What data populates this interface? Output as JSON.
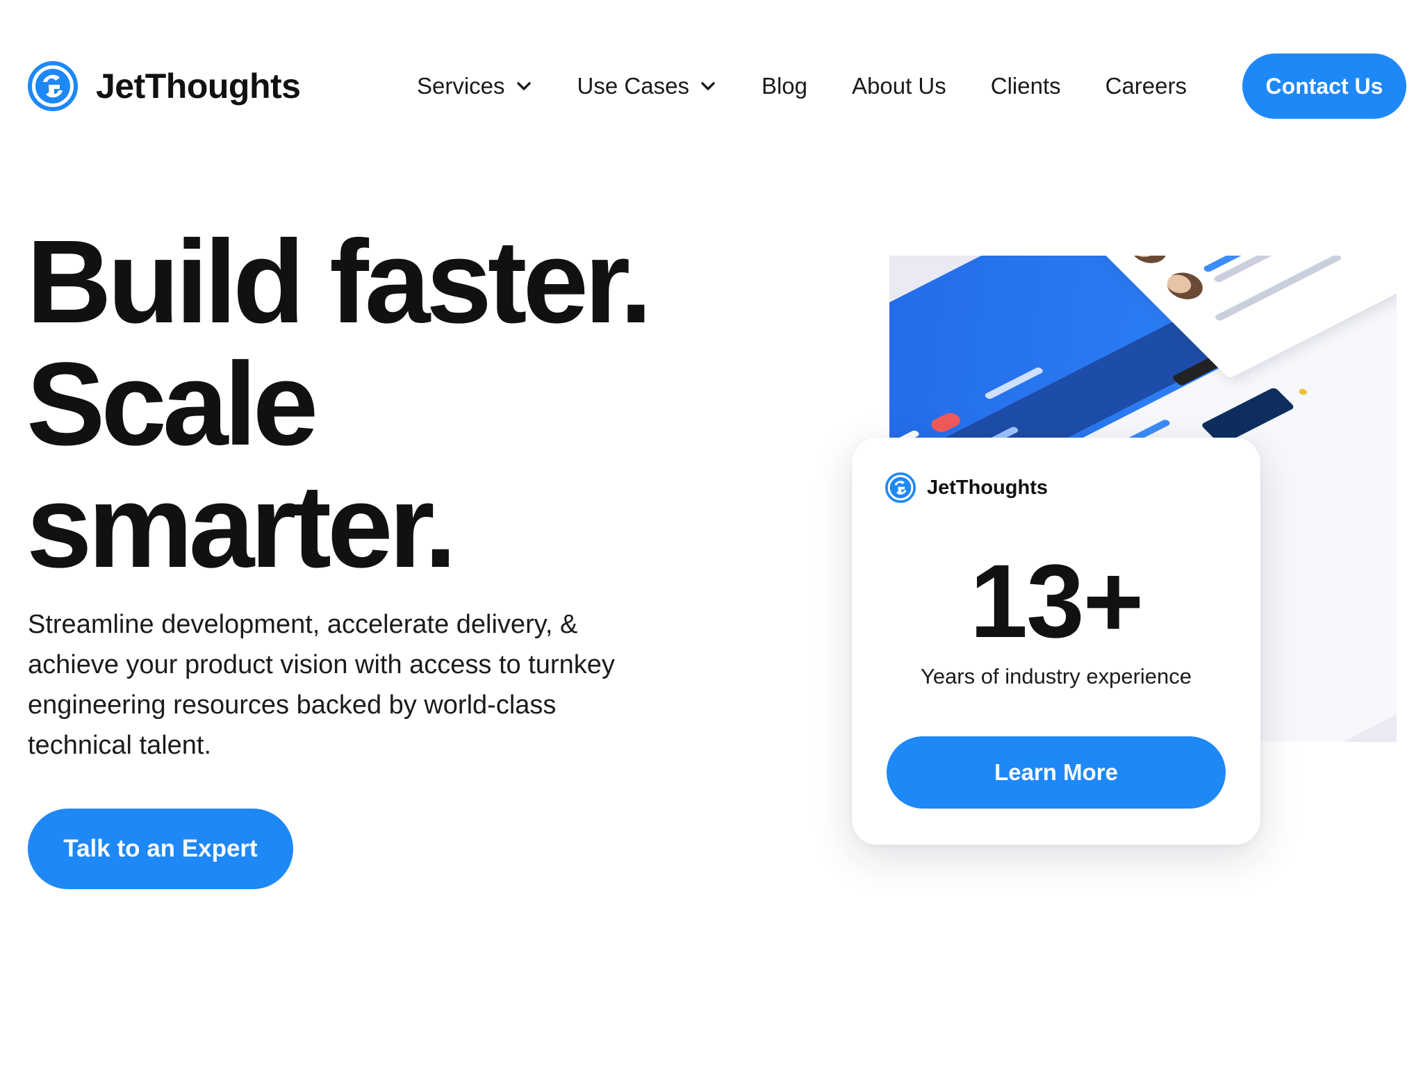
{
  "brand": {
    "name": "JetThoughts",
    "color": "#1e88f7"
  },
  "nav": {
    "items": [
      {
        "label": "Services",
        "has_dropdown": true
      },
      {
        "label": "Use Cases",
        "has_dropdown": true
      },
      {
        "label": "Blog"
      },
      {
        "label": "About Us"
      },
      {
        "label": "Clients"
      },
      {
        "label": "Careers"
      }
    ],
    "contact_label": "Contact Us"
  },
  "hero": {
    "headline": [
      "Build faster.",
      "Scale",
      "smarter."
    ],
    "subtext": "Streamline development, accelerate delivery, & achieve your product vision with access to turnkey engineering resources backed by world-class technical talent.",
    "cta_label": "Talk to an Expert"
  },
  "stat_card": {
    "brand_name": "JetThoughts",
    "value": "13+",
    "label": "Years of industry experience",
    "button_label": "Learn More"
  },
  "icons": {
    "logo": "jetthoughts-logo-icon",
    "dropdown": "chevron-down-icon"
  }
}
